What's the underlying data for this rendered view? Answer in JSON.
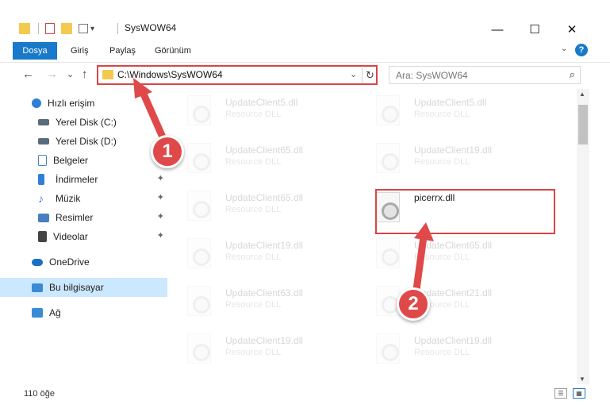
{
  "window": {
    "title": "SysWOW64",
    "minimize": "—",
    "maximize": "☐",
    "close": "✕"
  },
  "quickaccess": {
    "dropdown": "▾"
  },
  "ribbon": {
    "tabs": [
      {
        "label": "Dosya",
        "active": true
      },
      {
        "label": "Giriş"
      },
      {
        "label": "Paylaş"
      },
      {
        "label": "Görünüm"
      }
    ],
    "expand": "⌄",
    "help": "?"
  },
  "nav": {
    "back": "←",
    "forward": "→",
    "recent": "⌄",
    "up": "↑"
  },
  "address": {
    "path": "C:\\Windows\\SysWOW64",
    "dropdown": "⌄",
    "refresh": "↻"
  },
  "search": {
    "placeholder": "Ara: SysWOW64",
    "icon": "⌕"
  },
  "sidebar": {
    "items": [
      {
        "label": "Hızlı erişim",
        "icon": "star-icon",
        "color": "#2f7fd8"
      },
      {
        "label": "Yerel Disk (C:)",
        "icon": "drive-icon",
        "color": "#5a6b7a",
        "pinned": true
      },
      {
        "label": "Yerel Disk (D:)",
        "icon": "drive-icon",
        "color": "#5a6b7a",
        "pinned": true
      },
      {
        "label": "Belgeler",
        "icon": "documents-icon",
        "color": "#4a7fbf",
        "pinned": true
      },
      {
        "label": "İndirmeler",
        "icon": "download-icon",
        "color": "#2f7fd8",
        "pinned": true
      },
      {
        "label": "Müzik",
        "icon": "music-icon",
        "color": "#2f7fd8",
        "pinned": true
      },
      {
        "label": "Resimler",
        "icon": "pictures-icon",
        "color": "#4a7fbf",
        "pinned": true
      },
      {
        "label": "Videolar",
        "icon": "videos-icon",
        "color": "#444444",
        "pinned": true
      },
      {
        "label": "OneDrive",
        "icon": "cloud-icon",
        "color": "#1a6ec7"
      },
      {
        "label": "Bu bilgisayar",
        "icon": "computer-icon",
        "color": "#3a8bd6",
        "selected": true
      },
      {
        "label": "Ağ",
        "icon": "network-icon",
        "color": "#3a8bd6"
      }
    ],
    "pin_glyph": "📌"
  },
  "files": [
    {
      "name": "UpdateClient5.dll",
      "type": "Resource DLL",
      "faded": true
    },
    {
      "name": "UpdateClient5.dll",
      "type": "Resource DLL",
      "faded": true
    },
    {
      "name": "UpdateClient65.dll",
      "type": "Resource DLL",
      "faded": true
    },
    {
      "name": "UpdateClient19.dll",
      "type": "Resource DLL",
      "faded": true
    },
    {
      "name": "UpdateClient65.dll",
      "type": "Resource DLL",
      "faded": true
    },
    {
      "name": "picerrx.dll",
      "type": "",
      "faded": false
    },
    {
      "name": "UpdateClient19.dll",
      "type": "Resource DLL",
      "faded": true
    },
    {
      "name": "UpdateClient65.dll",
      "type": "Resource DLL",
      "faded": true
    },
    {
      "name": "UpdateClient63.dll",
      "type": "Resource DLL",
      "faded": true
    },
    {
      "name": "UpdateClient21.dll",
      "type": "Resource DLL",
      "faded": true
    },
    {
      "name": "UpdateClient19.dll",
      "type": "Resource DLL",
      "faded": true
    },
    {
      "name": "UpdateClient19.dll",
      "type": "Resource DLL",
      "faded": true
    }
  ],
  "status": {
    "count": "110 öğe",
    "details_view": "☰",
    "icons_view": "▦"
  },
  "steps": [
    "1",
    "2"
  ],
  "colors": {
    "accent": "#1979ca",
    "highlight": "#d94545",
    "selection": "#cce8ff"
  }
}
